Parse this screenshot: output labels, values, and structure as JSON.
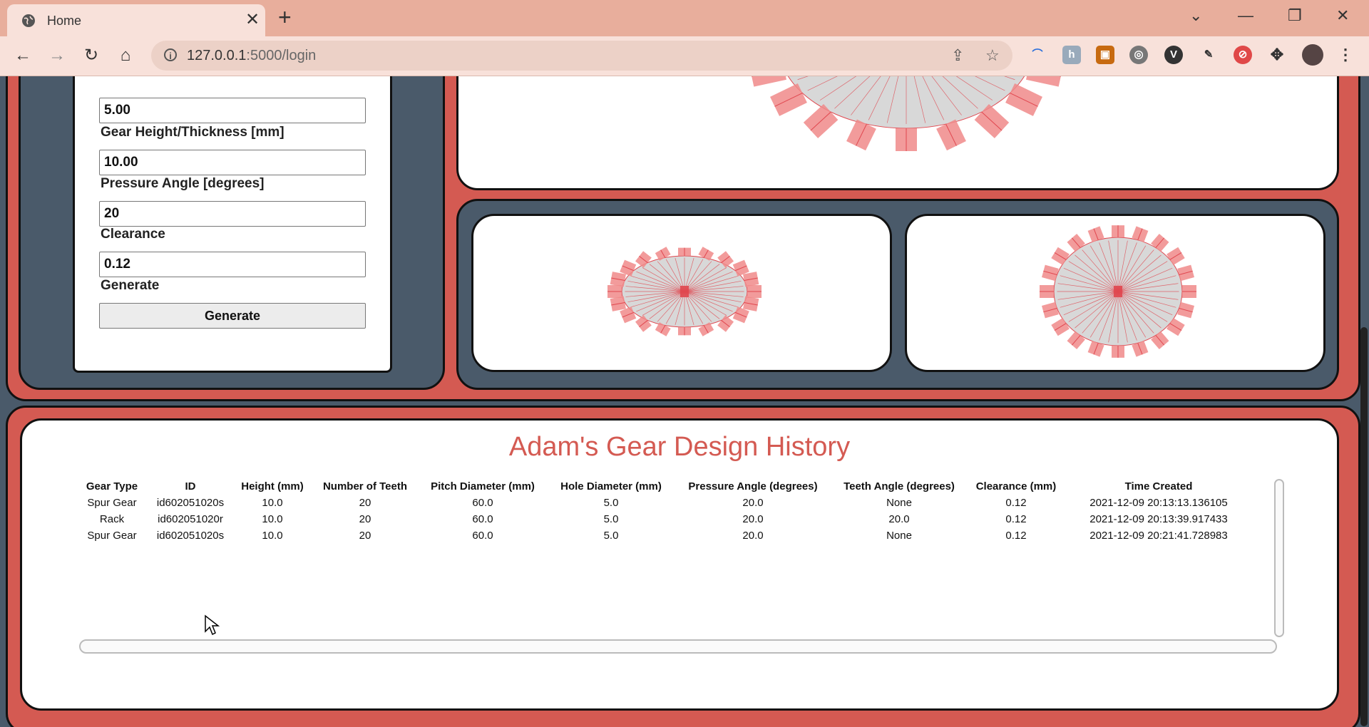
{
  "browser": {
    "tab_title": "Home",
    "url_host": "127.0.0.1",
    "url_rest": ":5000/login"
  },
  "form": {
    "fields": [
      {
        "label": "",
        "value": "5.00"
      },
      {
        "label": "Gear Height/Thickness [mm]",
        "value": "10.00"
      },
      {
        "label": "Pressure Angle [degrees]",
        "value": "20"
      },
      {
        "label": "Clearance",
        "value": "0.12"
      }
    ],
    "generate_label": "Generate",
    "generate_button": "Generate"
  },
  "history": {
    "title": "Adam's Gear Design History",
    "columns": [
      "Gear Type",
      "ID",
      "Height (mm)",
      "Number of Teeth",
      "Pitch Diameter (mm)",
      "Hole Diameter (mm)",
      "Pressure Angle (degrees)",
      "Teeth Angle (degrees)",
      "Clearance (mm)",
      "Time Created"
    ],
    "rows": [
      [
        "Spur Gear",
        "id602051020s",
        "10.0",
        "20",
        "60.0",
        "5.0",
        "20.0",
        "None",
        "0.12",
        "2021-12-09 20:13:13.136105"
      ],
      [
        "Rack",
        "id602051020r",
        "10.0",
        "20",
        "60.0",
        "5.0",
        "20.0",
        "20.0",
        "0.12",
        "2021-12-09 20:13:39.917433"
      ],
      [
        "Spur Gear",
        "id602051020s",
        "10.0",
        "20",
        "60.0",
        "5.0",
        "20.0",
        "None",
        "0.12",
        "2021-12-09 20:21:41.728983"
      ]
    ]
  },
  "colors": {
    "accent_red": "#d45a52",
    "panel_dark": "#4a5a6a",
    "gear_red": "#e0474f"
  }
}
